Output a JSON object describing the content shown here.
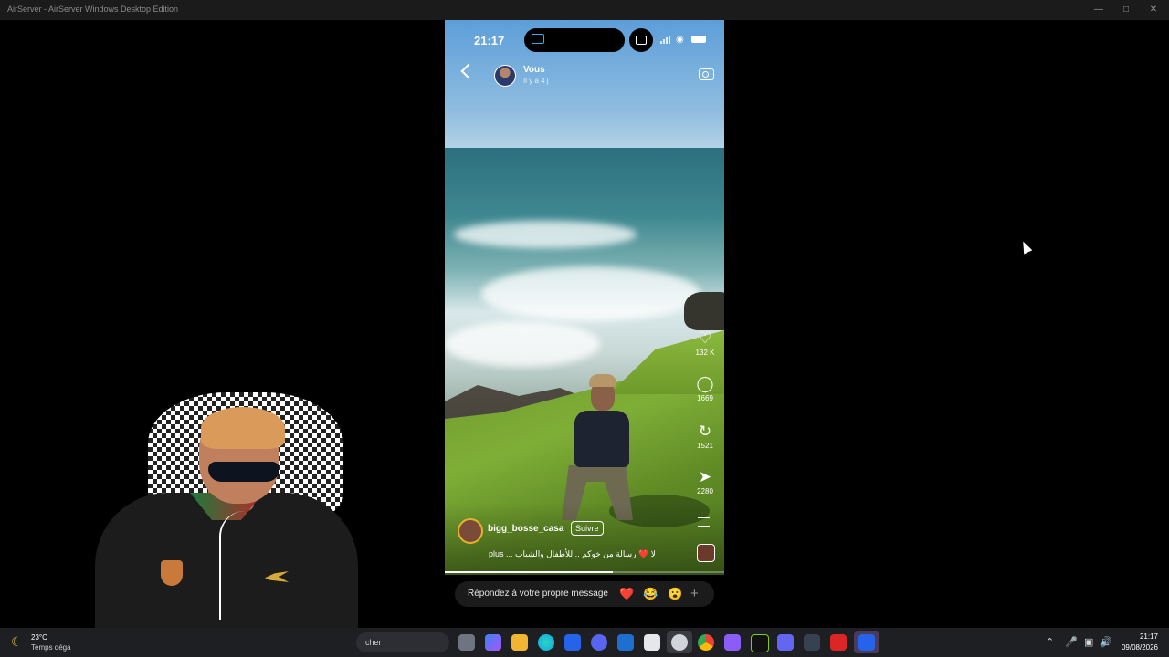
{
  "window": {
    "title": "AirServer - AirServer Windows Desktop Edition"
  },
  "phone": {
    "status": {
      "time": "21:17"
    },
    "story": {
      "user": "Vous",
      "time_ago": "Il y a 4 j"
    },
    "actions": {
      "likes": "132 K",
      "comments": "1669",
      "reposts": "1521",
      "shares": "2280"
    },
    "author": {
      "name": "bigg_bosse_casa",
      "follow": "Suivre"
    },
    "caption": "plus ... لا ❤️ رسالة من خوكم .. للأطفال والشباب",
    "progress": 0.6
  },
  "reply": {
    "placeholder": "Répondez à votre propre message",
    "reactions": [
      "❤️",
      "😂",
      "😮"
    ],
    "plus": "+"
  },
  "taskbar": {
    "weather_temp": "23°C",
    "weather_desc": "Temps déga",
    "search_text": "cher",
    "clock_time": "21:17",
    "clock_date": "09/08/2026"
  }
}
